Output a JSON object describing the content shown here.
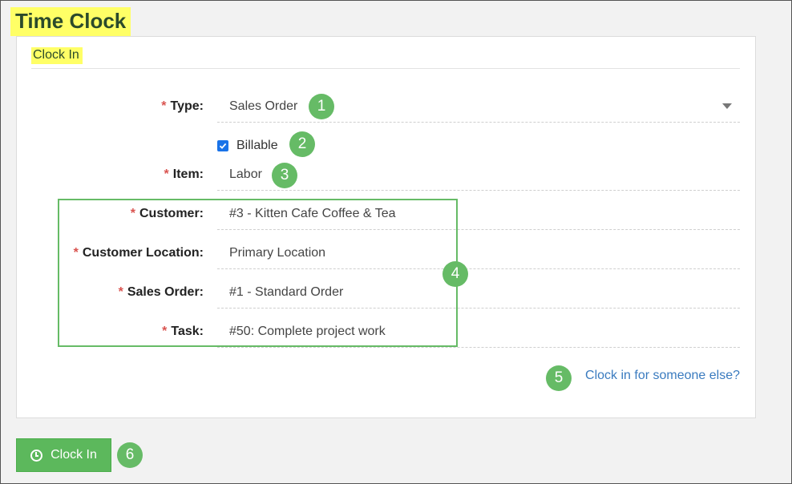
{
  "page": {
    "title": "Time Clock"
  },
  "form": {
    "section_title": "Clock In",
    "required_marker": "*",
    "type": {
      "label": "Type:",
      "value": "Sales Order"
    },
    "billable": {
      "label": "Billable",
      "checked": true
    },
    "item": {
      "label": "Item:",
      "value": "Labor"
    },
    "customer": {
      "label": "Customer:",
      "value": "#3 - Kitten Cafe Coffee & Tea"
    },
    "customer_location": {
      "label": "Customer Location:",
      "value": "Primary Location"
    },
    "sales_order": {
      "label": "Sales Order:",
      "value": "#1 - Standard Order"
    },
    "task": {
      "label": "Task:",
      "value": "#50: Complete project work"
    },
    "clock_in_other_link": "Clock in for someone else?",
    "clock_in_button": "Clock In"
  },
  "annotations": [
    "1",
    "2",
    "3",
    "4",
    "5",
    "6"
  ],
  "colors": {
    "highlight": "#ffff66",
    "badge": "#66bb66",
    "button": "#5cb85c",
    "link": "#3a7bbf",
    "required": "#d9534f"
  },
  "icons": {
    "button_icon": "clock-icon",
    "dropdown_icon": "caret-down-icon"
  }
}
